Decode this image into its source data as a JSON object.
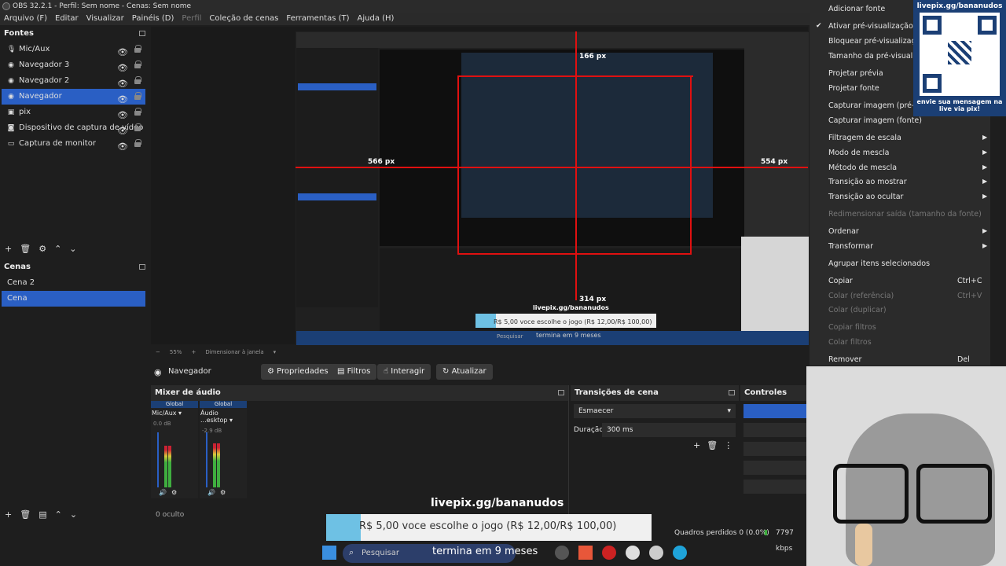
{
  "window": {
    "title": "OBS 32.2.1 - Perfil: Sem nome - Cenas: Sem nome"
  },
  "menu": [
    "Arquivo (F)",
    "Editar",
    "Visualizar",
    "Painéis (D)",
    "Perfil",
    "Coleção de cenas",
    "Ferramentas (T)",
    "Ajuda (H)"
  ],
  "sources": {
    "title": "Fontes",
    "items": [
      {
        "label": "Mic/Aux",
        "icon": "mic-icon"
      },
      {
        "label": "Navegador 3",
        "icon": "globe-icon"
      },
      {
        "label": "Navegador 2",
        "icon": "globe-icon"
      },
      {
        "label": "Navegador",
        "icon": "globe-icon",
        "selected": true
      },
      {
        "label": "pix",
        "icon": "image-icon"
      },
      {
        "label": "Dispositivo de captura de vídeo",
        "icon": "camera-icon"
      },
      {
        "label": "Captura de monitor",
        "icon": "monitor-icon"
      }
    ]
  },
  "scenes": {
    "title": "Cenas",
    "items": [
      {
        "label": "Cena 2"
      },
      {
        "label": "Cena",
        "selected": true
      }
    ]
  },
  "preview": {
    "px_labels": [
      "566 px",
      "554 px",
      "314 px",
      "166 px"
    ],
    "nested_labels": [
      "livepix.gg/bananudos",
      "R$ 5,00 voce escolhe o jogo (R$ 12,00/R$ 100,00)",
      "termina em 9 meses",
      "Pesquisar"
    ],
    "zoom": "55%",
    "zoom_label": "Dimensionar à janela"
  },
  "properties_bar": {
    "source": "Navegador",
    "buttons": [
      "Propriedades",
      "Filtros",
      "Interagir",
      "Atualizar"
    ]
  },
  "mixer": {
    "title": "Mixer de áudio",
    "channels": [
      {
        "tag": "Global",
        "name": "Mic/Aux",
        "db": "0.0 dB",
        "level": 0.75
      },
      {
        "tag": "Global",
        "name": "Áudio ...esktop",
        "db": "-2.9 dB",
        "level": 0.8
      }
    ],
    "scale": [
      "0",
      "-6",
      "-12",
      "-18",
      "-24",
      "-30",
      "-36",
      "-42",
      "-48",
      "-54",
      "-60"
    ],
    "hidden": "0 oculto"
  },
  "transitions": {
    "title": "Transições de cena",
    "selected": "Esmaecer",
    "duration_label": "Duração",
    "duration": "300 ms"
  },
  "controls": {
    "title": "Controles"
  },
  "context_menu": [
    {
      "label": "Adicionar fonte"
    },
    {
      "label": "Ativar pré-visualização",
      "checked": true
    },
    {
      "label": "Bloquear pré-visualização"
    },
    {
      "label": "Tamanho da pré-visualização"
    },
    {
      "label": "Projetar prévia"
    },
    {
      "label": "Projetar fonte"
    },
    {
      "label": "Capturar imagem (pré-visualização)"
    },
    {
      "label": "Capturar imagem (fonte)"
    },
    {
      "label": "Filtragem de escala",
      "submenu": true
    },
    {
      "label": "Modo de mescla",
      "submenu": true
    },
    {
      "label": "Método de mescla",
      "submenu": true
    },
    {
      "label": "Transição ao mostrar",
      "submenu": true
    },
    {
      "label": "Transição ao ocultar",
      "submenu": true
    },
    {
      "label": "Redimensionar saída (tamanho da fonte)",
      "disabled": true
    },
    {
      "label": "Ordenar",
      "submenu": true
    },
    {
      "label": "Transformar",
      "submenu": true
    },
    {
      "label": "Agrupar itens selecionados"
    },
    {
      "label": "Copiar",
      "shortcut": "Ctrl+C"
    },
    {
      "label": "Colar (referência)",
      "shortcut": "Ctrl+V",
      "disabled": true
    },
    {
      "label": "Colar (duplicar)",
      "disabled": true
    },
    {
      "label": "Copiar filtros",
      "disabled": true
    },
    {
      "label": "Colar filtros",
      "disabled": true
    },
    {
      "label": "Remover",
      "shortcut": "Del"
    }
  ],
  "overlay": {
    "qr_header": "livepix.gg/bananudos",
    "qr_footer": "envie sua mensagem na live via pix!",
    "banner_url": "livepix.gg/bananudos",
    "banner_text": "R$ 5,00 voce escolhe o jogo (R$ 12,00/R$ 100,00)",
    "banner_sub": "termina em 9 meses"
  },
  "statusbar": {
    "dropped": "Quadros perdidos 0 (0.0%)",
    "bitrate": "7797 kbps"
  },
  "taskbar": {
    "search": "Pesquisar"
  },
  "colors": {
    "accent": "#2a5fc4",
    "guide": "#e01010",
    "panel": "#1e1e1e"
  }
}
